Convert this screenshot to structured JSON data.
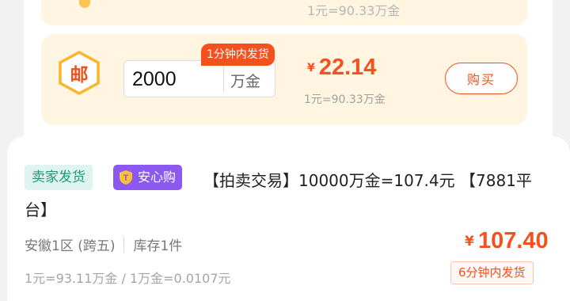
{
  "previous_offer": {
    "rate_text": "1元=90.33万金"
  },
  "offer": {
    "badge_char": "邮",
    "quantity_value": "2000",
    "quantity_unit": "万金",
    "delivery_tag": "1分钟内发货",
    "currency_symbol": "¥",
    "price": "22.14",
    "rate_text": "1元=90.33万金",
    "buy_label": "购买"
  },
  "product": {
    "tag_seller": "卖家发货",
    "tag_safe": "安心购",
    "title": "【拍卖交易】10000万金=107.4元 【7881平台】",
    "server": "安徽1区 (跨五)",
    "stock": "库存1件",
    "currency_symbol": "¥",
    "price": "107.40",
    "rate_text": "1元=93.11万金 / 1万金=0.0107元",
    "delivery_tag": "6分钟内发货"
  },
  "colors": {
    "accent": "#f4511e",
    "offer_bg": "#fff5e1",
    "seller_tag_bg": "#dff4ee",
    "safe_tag_bg": "#8b58f0"
  },
  "icons": {
    "post_badge": "hexagon-post-icon",
    "safe_shield": "shield-t-icon"
  }
}
